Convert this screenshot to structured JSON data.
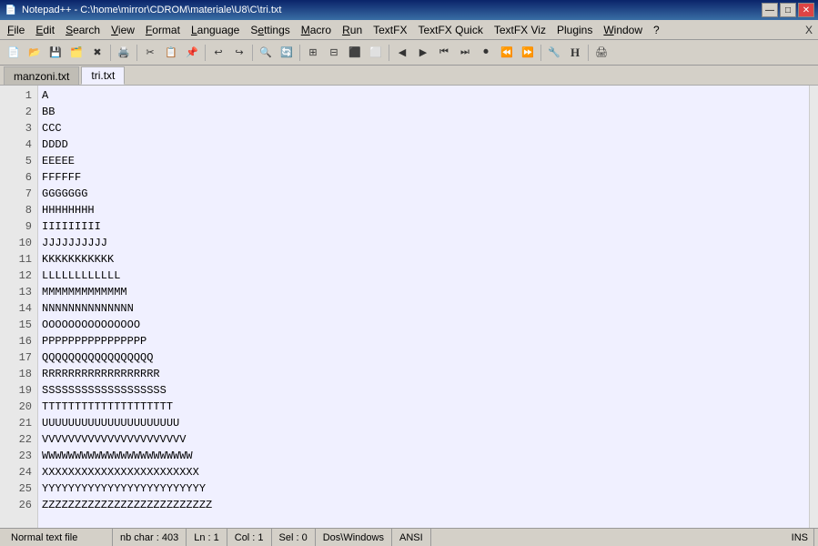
{
  "titlebar": {
    "title": "Notepad++ - C:\\home\\mirror\\CDROM\\materiale\\U8\\C\\tri.txt",
    "icon": "📄"
  },
  "window_controls": {
    "minimize": "—",
    "maximize": "□",
    "close": "✕"
  },
  "menu": {
    "items": [
      "File",
      "Edit",
      "Search",
      "View",
      "Format",
      "Language",
      "Settings",
      "Macro",
      "Run",
      "TextFX",
      "TextFX Quick",
      "TextFX Viz",
      "Plugins",
      "Window",
      "?"
    ]
  },
  "tabs": [
    {
      "label": "manzoni.txt",
      "active": false
    },
    {
      "label": "tri.txt",
      "active": true
    }
  ],
  "editor": {
    "lines": [
      "A",
      "BB",
      "CCC",
      "DDDD",
      "EEEEE",
      "FFFFFF",
      "GGGGGGG",
      "HHHHHHHH",
      "IIIIIIIII",
      "JJJJJJJJJJ",
      "KKKKKKKKKKK",
      "LLLLLLLLLLLL",
      "MMMMMMMMMMMMM",
      "NNNNNNNNNNNNNN",
      "OOOOOOOOOOOOOOO",
      "PPPPPPPPPPPPPPPP",
      "QQQQQQQQQQQQQQQQQ",
      "RRRRRRRRRRRRRRRRRR",
      "SSSSSSSSSSSSSSSSSSS",
      "TTTTTTTTTTTTTTTTTTTT",
      "UUUUUUUUUUUUUUUUUUUUU",
      "VVVVVVVVVVVVVVVVVVVVVV",
      "WWWWWWWWWWWWWWWWWWWWWWW",
      "XXXXXXXXXXXXXXXXXXXXXXXX",
      "YYYYYYYYYYYYYYYYYYYYYYYYY",
      "ZZZZZZZZZZZZZZZZZZZZZZZZZZ"
    ]
  },
  "statusbar": {
    "file_type": "Normal text file",
    "nb_char": "nb char : 403",
    "ln": "Ln : 1",
    "col": "Col : 1",
    "sel": "Sel : 0",
    "line_ending": "Dos\\Windows",
    "encoding": "ANSI",
    "ins": "INS"
  }
}
